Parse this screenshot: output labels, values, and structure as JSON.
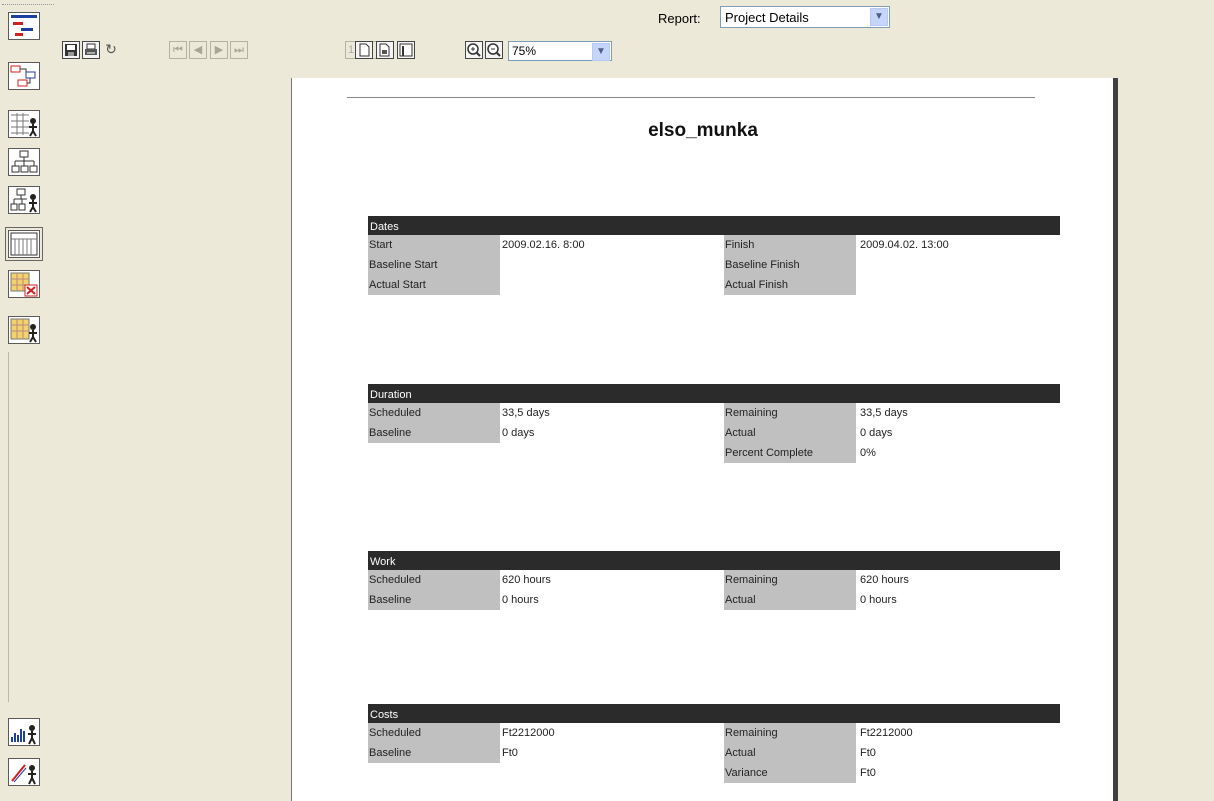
{
  "report": {
    "label": "Report:",
    "selected": "Project Details"
  },
  "toolbar": {
    "page_number": "1",
    "zoom": "75%"
  },
  "document": {
    "title": "elso_munka",
    "sections": [
      {
        "heading": "Dates",
        "rows": [
          {
            "label1": "Start",
            "value1": "2009.02.16. 8:00",
            "label2": "Finish",
            "value2": "2009.04.02. 13:00"
          },
          {
            "label1": "Baseline Start",
            "value1": "",
            "label2": "Baseline Finish",
            "value2": ""
          },
          {
            "label1": "Actual Start",
            "value1": "",
            "label2": "Actual Finish",
            "value2": ""
          }
        ]
      },
      {
        "heading": "Duration",
        "rows": [
          {
            "label1": "Scheduled",
            "value1": "33,5 days",
            "label2": "Remaining",
            "value2": "33,5 days"
          },
          {
            "label1": "Baseline",
            "value1": "0 days",
            "label2": "Actual",
            "value2": "0 days"
          },
          {
            "label1": "",
            "value1": "",
            "label2": "Percent Complete",
            "value2": "0%"
          }
        ]
      },
      {
        "heading": "Work",
        "rows": [
          {
            "label1": "Scheduled",
            "value1": "620 hours",
            "label2": "Remaining",
            "value2": "620 hours"
          },
          {
            "label1": "Baseline",
            "value1": "0 hours",
            "label2": "Actual",
            "value2": "0 hours"
          }
        ]
      },
      {
        "heading": "Costs",
        "rows": [
          {
            "label1": "Scheduled",
            "value1": "Ft2212000",
            "label2": "Remaining",
            "value2": "Ft2212000"
          },
          {
            "label1": "Baseline",
            "value1": "Ft0",
            "label2": "Actual",
            "value2": "Ft0"
          },
          {
            "label1": "",
            "value1": "",
            "label2": "Variance",
            "value2": "Ft0"
          }
        ]
      }
    ]
  },
  "viewbar_icons": [
    "gantt-chart-icon",
    "network-diagram-icon",
    "resource-sheet-icon",
    "wbs-chart-icon",
    "resource-wbs-icon",
    "calendar-grid-icon",
    "task-sheet-delete-icon",
    "resource-usage-icon",
    "resource-graph-icon",
    "tracking-gantt-icon"
  ]
}
